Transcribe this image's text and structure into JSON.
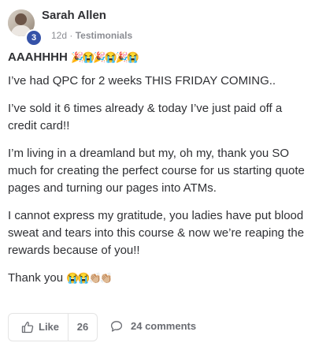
{
  "post": {
    "author": "Sarah Allen",
    "level": "3",
    "time": "12d",
    "separator": "·",
    "category": "Testimonials",
    "title": "AAAHHHH",
    "title_emoji": "🎉😭🎉😭🎉😭",
    "paragraphs": [
      "I’ve had QPC for 2 weeks THIS FRIDAY COMING..",
      "I’ve sold it 6 times already & today I’ve just paid off a credit card!!",
      "I’m living in a dreamland but my, oh my, thank you SO much for creating the perfect course for us starting quote pages and turning our pages into ATMs.",
      "I cannot express my gratitude, you ladies have put blood sweat and tears into this course & now we’re reaping the rewards because of you!!"
    ],
    "closing": "Thank you",
    "closing_emoji": "😭😭👏🏼👏🏼"
  },
  "actions": {
    "like_label": "Like",
    "like_count": "26",
    "comments_label": "24 comments"
  },
  "icons": {
    "like": "thumbs-up-icon",
    "comment": "comment-bubble-icon"
  },
  "colors": {
    "text": "#2f3034",
    "muted": "#8b8d93",
    "badge": "#3552a8",
    "border": "#e4e4e4"
  }
}
